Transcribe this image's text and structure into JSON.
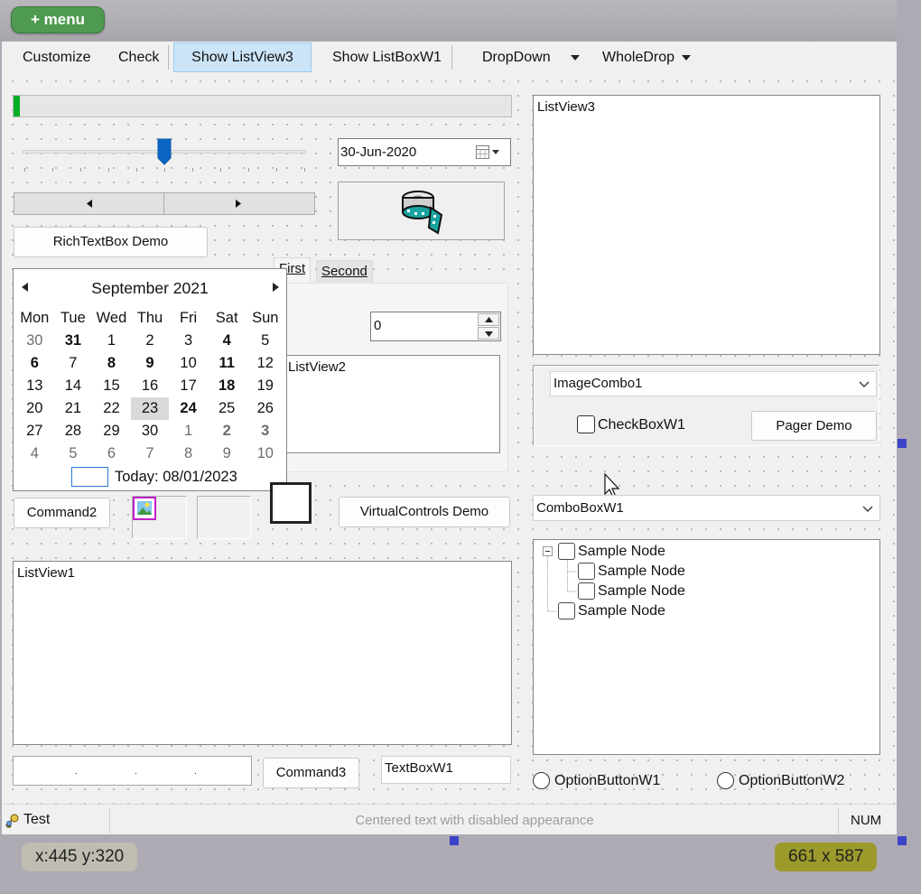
{
  "menu_button": "+ menu",
  "toolbar": {
    "customize": "Customize",
    "check": "Check",
    "show_listview3": "Show ListView3",
    "show_listboxw1": "Show ListBoxW1",
    "dropdown": "DropDown",
    "wholedrop": "WholeDrop"
  },
  "progress": {
    "fraction": 0.012,
    "color": "#06b025"
  },
  "slider": {
    "fraction": 0.5,
    "color": "#0a66c2"
  },
  "datepicker": {
    "value": "30-Jun-2020"
  },
  "buttons": {
    "richtextbox_demo": "RichTextBox Demo",
    "command2": "Command2",
    "virtualcontrols_demo": "VirtualControls Demo",
    "command3": "Command3",
    "pager_demo": "Pager Demo"
  },
  "calendar": {
    "month_label": "September 2021",
    "weekdays": [
      "Mon",
      "Tue",
      "Wed",
      "Thu",
      "Fri",
      "Sat",
      "Sun"
    ],
    "weeks": [
      [
        {
          "d": "30",
          "grey": true
        },
        {
          "d": "31",
          "bold": true
        },
        {
          "d": "1"
        },
        {
          "d": "2"
        },
        {
          "d": "3"
        },
        {
          "d": "4",
          "bold": true
        },
        {
          "d": "5"
        }
      ],
      [
        {
          "d": "6",
          "bold": true
        },
        {
          "d": "7"
        },
        {
          "d": "8",
          "bold": true
        },
        {
          "d": "9",
          "bold": true
        },
        {
          "d": "10"
        },
        {
          "d": "11",
          "bold": true
        },
        {
          "d": "12"
        }
      ],
      [
        {
          "d": "13"
        },
        {
          "d": "14"
        },
        {
          "d": "15"
        },
        {
          "d": "16"
        },
        {
          "d": "17"
        },
        {
          "d": "18",
          "bold": true
        },
        {
          "d": "19"
        }
      ],
      [
        {
          "d": "20"
        },
        {
          "d": "21"
        },
        {
          "d": "22"
        },
        {
          "d": "23",
          "selected": true
        },
        {
          "d": "24",
          "bold": true
        },
        {
          "d": "25"
        },
        {
          "d": "26"
        }
      ],
      [
        {
          "d": "27"
        },
        {
          "d": "28"
        },
        {
          "d": "29"
        },
        {
          "d": "30"
        },
        {
          "d": "1",
          "grey": true
        },
        {
          "d": "2",
          "bold": true,
          "grey": true
        },
        {
          "d": "3",
          "bold": true,
          "grey": true
        }
      ],
      [
        {
          "d": "4",
          "grey": true
        },
        {
          "d": "5",
          "grey": true
        },
        {
          "d": "6",
          "grey": true
        },
        {
          "d": "7",
          "grey": true
        },
        {
          "d": "8",
          "grey": true
        },
        {
          "d": "9",
          "grey": true
        },
        {
          "d": "10",
          "grey": true
        }
      ]
    ],
    "today_label": "Today: 08/01/2023"
  },
  "tabs": {
    "first": "First",
    "second": "Second"
  },
  "spinner": {
    "value": "0"
  },
  "listview1": {
    "label": "ListView1"
  },
  "listview2": {
    "label": "ListView2"
  },
  "listview3": {
    "label": "ListView3"
  },
  "textboxw1": {
    "value": "TextBoxW1"
  },
  "imagecombo1": {
    "value": "ImageCombo1"
  },
  "checkboxw1": {
    "label": "CheckBoxW1"
  },
  "comboboxw1": {
    "value": "ComboBoxW1"
  },
  "tree": {
    "nodes": [
      "Sample Node",
      "Sample Node",
      "Sample Node",
      "Sample Node"
    ]
  },
  "options": {
    "option1": "OptionButtonW1",
    "option2": "OptionButtonW2"
  },
  "statusbar": {
    "test": "Test",
    "center": "Centered text with disabled appearance",
    "num": "NUM"
  },
  "overlay": {
    "coords": "x:445 y:320",
    "size": "661 x 587"
  }
}
